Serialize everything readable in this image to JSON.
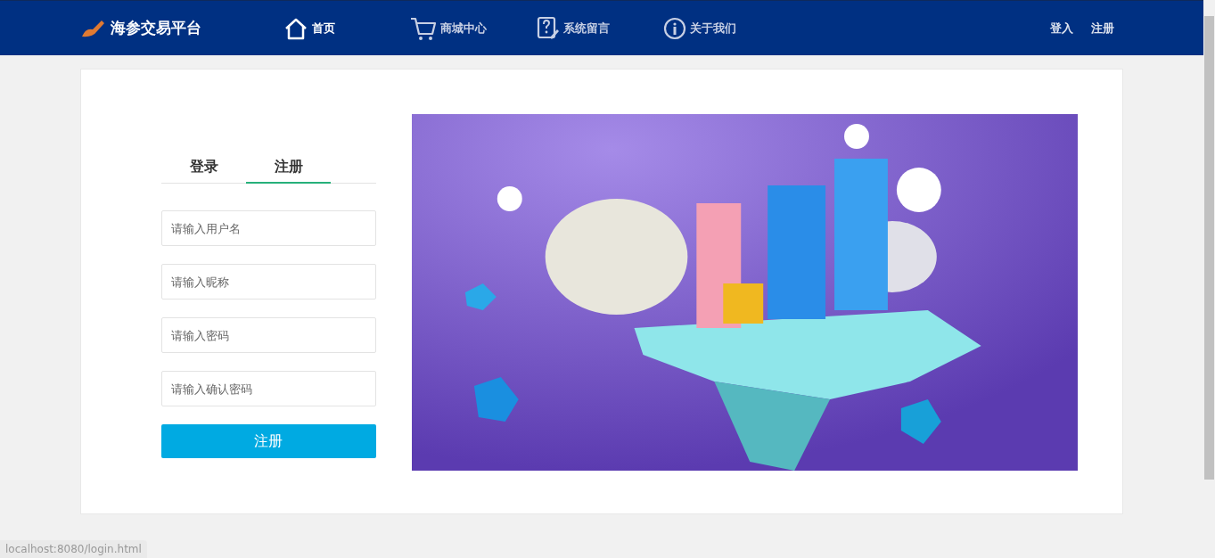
{
  "header": {
    "brand": "海参交易平台",
    "nav": [
      {
        "label": "首页",
        "selected": true
      },
      {
        "label": "商城中心",
        "selected": false
      },
      {
        "label": "系统留言",
        "selected": false
      },
      {
        "label": "关于我们",
        "selected": false
      }
    ],
    "auth_links": [
      "登入",
      "注册"
    ]
  },
  "form": {
    "tabs": [
      {
        "label": "登录",
        "selected": false
      },
      {
        "label": "注册",
        "selected": true
      }
    ],
    "fields": [
      {
        "placeholder": "请输入用户名"
      },
      {
        "placeholder": "请输入昵称"
      },
      {
        "placeholder": "请输入密码"
      },
      {
        "placeholder": "请输入确认密码"
      }
    ],
    "submit": "注册"
  },
  "status_bar": "localhost:8080/login.html"
}
